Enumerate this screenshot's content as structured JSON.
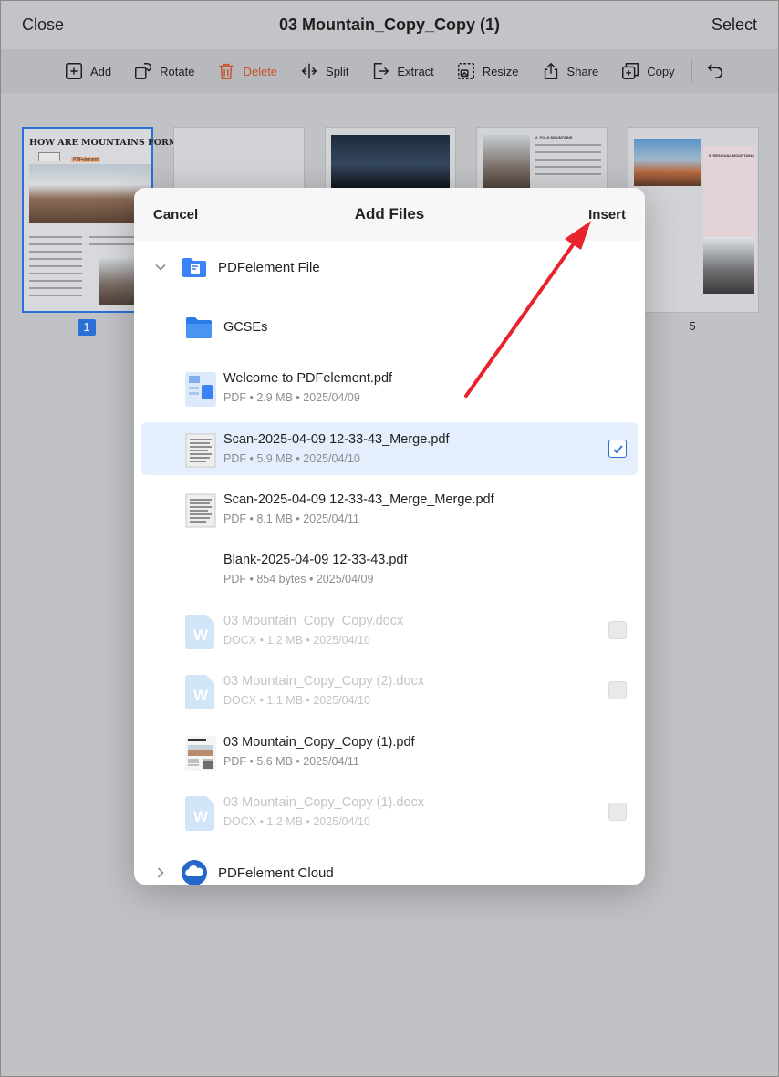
{
  "topbar": {
    "close_label": "Close",
    "title": "03 Mountain_Copy_Copy (1)",
    "select_label": "Select"
  },
  "toolbar": {
    "add": "Add",
    "rotate": "Rotate",
    "delete": "Delete",
    "split": "Split",
    "extract": "Extract",
    "resize": "Resize",
    "share": "Share",
    "copy": "Copy"
  },
  "thumbnails": {
    "first_page_heading": "HOW ARE MOUNTAINS FORMED?",
    "first_page_badge": "PDFelement",
    "page4_heading": "2. FOLD MOUNTAINS",
    "page5_heading": "5. RESIDUAL MOUNTAINS",
    "page_numbers": [
      "1",
      "5"
    ]
  },
  "modal": {
    "cancel_label": "Cancel",
    "title": "Add Files",
    "insert_label": "Insert",
    "root_folder": "PDFelement File",
    "cloud_folder": "PDFelement Cloud",
    "subfolder": "GCSEs",
    "files": [
      {
        "name": "Welcome to PDFelement.pdf",
        "meta": "PDF • 2.9 MB • 2025/04/09",
        "icon": "pdf-welcome-icon",
        "selected": false,
        "disabled": false
      },
      {
        "name": "Scan-2025-04-09 12-33-43_Merge.pdf",
        "meta": "PDF • 5.9 MB • 2025/04/10",
        "icon": "scan-doc-icon",
        "selected": true,
        "disabled": false
      },
      {
        "name": "Scan-2025-04-09 12-33-43_Merge_Merge.pdf",
        "meta": "PDF • 8.1 MB • 2025/04/11",
        "icon": "scan-doc-icon",
        "selected": false,
        "disabled": false
      },
      {
        "name": "Blank-2025-04-09 12-33-43.pdf",
        "meta": "PDF • 854 bytes • 2025/04/09",
        "icon": "blank-doc-icon",
        "selected": false,
        "disabled": false
      },
      {
        "name": "03 Mountain_Copy_Copy.docx",
        "meta": "DOCX • 1.2 MB • 2025/04/10",
        "icon": "word-doc-icon",
        "selected": false,
        "disabled": true
      },
      {
        "name": "03 Mountain_Copy_Copy (2).docx",
        "meta": "DOCX • 1.1 MB • 2025/04/10",
        "icon": "word-doc-icon",
        "selected": false,
        "disabled": true
      },
      {
        "name": "03 Mountain_Copy_Copy (1).pdf",
        "meta": "PDF • 5.6 MB • 2025/04/11",
        "icon": "pdf-mountain-icon",
        "selected": false,
        "disabled": false
      },
      {
        "name": "03 Mountain_Copy_Copy (1).docx",
        "meta": "DOCX • 1.2 MB • 2025/04/10",
        "icon": "word-doc-icon",
        "selected": false,
        "disabled": true
      }
    ]
  },
  "colors": {
    "accent": "#2c6fd6",
    "delete": "#c7522b",
    "annotation_arrow": "#e8232b",
    "selected_row": "#e5eefc"
  }
}
